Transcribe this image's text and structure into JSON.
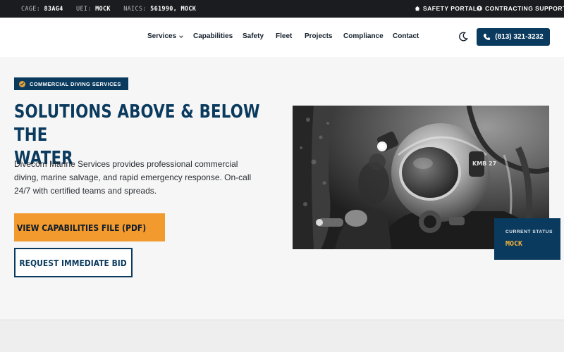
{
  "topbar": {
    "ids": [
      {
        "key": "CAGE:",
        "value": "83AG4"
      },
      {
        "key": "UEI:",
        "value": "MOCK"
      },
      {
        "key": "NAICS:",
        "value": "561990, MOCK"
      }
    ],
    "links": [
      {
        "icon": "home-icon",
        "label": "SAFETY PORTAL"
      },
      {
        "icon": "user-circle-icon",
        "label": "CONTRACTING SUPPORT"
      }
    ]
  },
  "nav": {
    "items": [
      "Services",
      "Capabilities",
      "Safety",
      "Fleet",
      "Projects",
      "Compliance",
      "Contact"
    ],
    "phone": "(813) 321-3232"
  },
  "hero": {
    "badge": "COMMERCIAL DIVING SERVICES",
    "headline_line1": "SOLUTIONS ABOVE & BELOW THE",
    "headline_line2": "WATER",
    "lead": "Divecom Marine Services provides professional commercial diving, marine salvage, and rapid emergency response. On-call 24/7 with certified teams and spreads.",
    "primary_cta": "VIEW CAPABILITIES FILE (PDF)",
    "secondary_cta": "REQUEST IMMEDIATE BID",
    "helmet_tag": "KMB 27",
    "status_label": "CURRENT STATUS",
    "status_value": "MOCK"
  },
  "colors": {
    "brand_navy": "#0a3a5e",
    "accent_orange": "#f29a2e",
    "status_gold": "#f2b23a",
    "topbar_bg": "#1a1c1f"
  }
}
